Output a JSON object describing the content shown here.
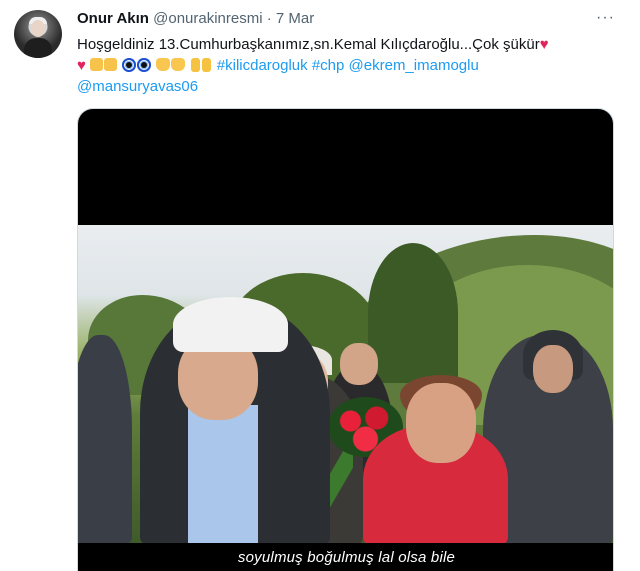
{
  "tweet": {
    "author_name": "Onur Akın",
    "author_handle": "@onurakinresmi",
    "separator": "·",
    "date": "7 Mar",
    "more_label": "···",
    "text_line1": "Hoşgeldiniz 13.Cumhurbaşkanımız,sn.Kemal Kılıçdaroğlu...Çok şükür",
    "links": {
      "hashtag_kilicdaroglu": "#kilicdarogluk",
      "hashtag_chp": "#chp",
      "mention_imamoglu": "@ekrem_imamoglu",
      "mention_yavas": "@mansuryavas06"
    },
    "emojis": [
      "red-heart",
      "folded-hands",
      "folded-hands",
      "nazar-amulet",
      "nazar-amulet",
      "clapping-hands",
      "clapping-hands",
      "victory-hand",
      "victory-hand"
    ]
  },
  "video": {
    "caption": "soyulmuş boğulmuş lal olsa bile"
  },
  "colors": {
    "link": "#1d9bf0",
    "secondary_text": "#536471",
    "heart": "#e0245e"
  }
}
